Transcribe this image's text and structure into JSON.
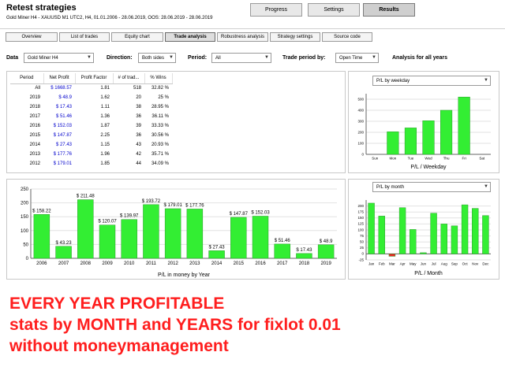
{
  "window": {
    "title": "Retest strategies",
    "subtitle": "Gold Miner H4 - XAUUSD  M1  UTC2, H4, 01.01.2006 - 28.06.2019, OOS: 28.06.2019 - 28.06.2019"
  },
  "top_buttons": [
    {
      "label": "Progress",
      "active": false
    },
    {
      "label": "Settings",
      "active": false
    },
    {
      "label": "Results",
      "active": true
    }
  ],
  "tabs": [
    {
      "label": "Overview",
      "active": false
    },
    {
      "label": "List of trades",
      "active": false
    },
    {
      "label": "Equity chart",
      "active": false
    },
    {
      "label": "Trade analysis",
      "active": true
    },
    {
      "label": "Robustness analysis",
      "active": false
    },
    {
      "label": "Strategy settings",
      "active": false
    },
    {
      "label": "Source code",
      "active": false
    }
  ],
  "filters": {
    "data_label": "Data",
    "data_value": "Gold Miner H4",
    "direction_label": "Direction:",
    "direction_value": "Both sides",
    "period_label": "Period:",
    "period_value": "All",
    "trade_period_label": "Trade period by:",
    "trade_period_value": "Open Time",
    "analysis_label": "Analysis for all years"
  },
  "table": {
    "headers": [
      "Period",
      "Net Profit",
      "Profit Factor",
      "# of trad...",
      "% Wins"
    ],
    "rows": [
      [
        "All",
        "$ 1668.57",
        "1.81",
        "518",
        "32.82 %"
      ],
      [
        "2019",
        "$ 48.9",
        "1.62",
        "20",
        "25 %"
      ],
      [
        "2018",
        "$ 17.43",
        "1.11",
        "38",
        "28.95 %"
      ],
      [
        "2017",
        "$ 51.46",
        "1.36",
        "36",
        "36.11 %"
      ],
      [
        "2016",
        "$ 152.03",
        "1.87",
        "39",
        "33.33 %"
      ],
      [
        "2015",
        "$ 147.87",
        "2.25",
        "36",
        "30.56 %"
      ],
      [
        "2014",
        "$ 27.43",
        "1.15",
        "43",
        "20.93 %"
      ],
      [
        "2013",
        "$ 177.76",
        "1.96",
        "42",
        "35.71 %"
      ],
      [
        "2012",
        "$ 179.01",
        "1.85",
        "44",
        "34.09 %"
      ]
    ]
  },
  "weekday_panel": {
    "select_value": "P/L by weekday"
  },
  "month_panel": {
    "select_value": "P/L by month"
  },
  "bottom_text": [
    "EVERY YEAR PROFITABLE",
    "stats by MONTH and YEARS for fixlot 0.01",
    "without moneymanagement"
  ],
  "colors": {
    "bar": "#33ee33",
    "negative_bar": "#ee2222",
    "net_profit_text": "#0000cc",
    "banner": "#ff1e1e"
  },
  "chart_data": [
    {
      "type": "bar",
      "xlabel": "P/L in money by Year",
      "categories": [
        "2006",
        "2007",
        "2008",
        "2009",
        "2010",
        "2011",
        "2012",
        "2013",
        "2014",
        "2015",
        "2016",
        "2017",
        "2018",
        "2019"
      ],
      "values": [
        158.22,
        43.23,
        211.48,
        120.07,
        139.97,
        193.72,
        179.01,
        177.76,
        27.43,
        147.87,
        152.03,
        51.46,
        17.43,
        48.9
      ],
      "labels": [
        "$ 158.22",
        "$ 43.23",
        "$ 211.48",
        "$ 120.07",
        "$ 139.97",
        "$ 193.72",
        "$ 179.01",
        "$ 177.76",
        "$ 27.43",
        "$ 147.87",
        "$ 152.03",
        "$ 51.46",
        "$ 17.43",
        "$ 48.9"
      ],
      "yticks": [
        0,
        50,
        100,
        150,
        200,
        250
      ],
      "ylim": [
        0,
        250
      ]
    },
    {
      "type": "bar",
      "xlabel": "P/L / Weekday",
      "categories": [
        "Sun",
        "Mon",
        "Tue",
        "Wed",
        "Thu",
        "Fri",
        "Sat"
      ],
      "values": [
        0,
        205,
        240,
        305,
        400,
        520,
        0
      ],
      "yticks": [
        0,
        100,
        200,
        300,
        400,
        500
      ],
      "ylim": [
        0,
        550
      ]
    },
    {
      "type": "bar",
      "xlabel": "P/L / Month",
      "categories": [
        "Jan",
        "Feb",
        "Mar",
        "Apr",
        "May",
        "Jun",
        "Jul",
        "Aug",
        "Sep",
        "Oct",
        "Nov",
        "Dec"
      ],
      "values": [
        212,
        158,
        -10,
        193,
        102,
        5,
        170,
        125,
        117,
        205,
        190,
        160
      ],
      "yticks": [
        -25,
        0,
        25,
        50,
        75,
        100,
        125,
        150,
        175,
        200
      ],
      "ylim": [
        -25,
        225
      ]
    }
  ]
}
